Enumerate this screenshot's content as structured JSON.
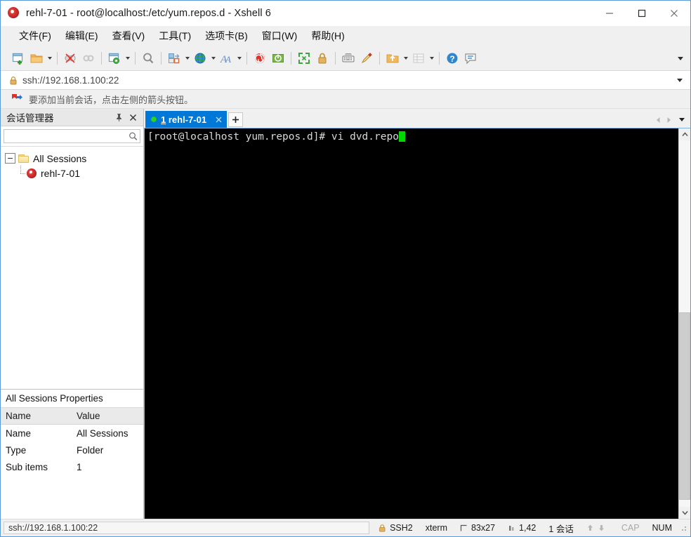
{
  "window": {
    "title": "rehl-7-01 - root@localhost:/etc/yum.repos.d - Xshell 6",
    "app_icon": "xshell-spiral-icon",
    "minimize_label": "—",
    "maximize_label": "□",
    "close_label": "✕"
  },
  "menubar": {
    "items": [
      {
        "label": "文件(F)",
        "name": "menu-file"
      },
      {
        "label": "编辑(E)",
        "name": "menu-edit"
      },
      {
        "label": "查看(V)",
        "name": "menu-view"
      },
      {
        "label": "工具(T)",
        "name": "menu-tools"
      },
      {
        "label": "选项卡(B)",
        "name": "menu-tabs"
      },
      {
        "label": "窗口(W)",
        "name": "menu-window"
      },
      {
        "label": "帮助(H)",
        "name": "menu-help"
      }
    ]
  },
  "toolbar": {
    "overflow_icon": "chevron-down-icon",
    "items": [
      {
        "name": "new-session-icon",
        "icon": "new-session"
      },
      {
        "name": "open-session-icon",
        "icon": "open-folder",
        "dropdown": true
      },
      {
        "name": "separator",
        "icon": "separator"
      },
      {
        "name": "disconnect-icon",
        "icon": "disconnect"
      },
      {
        "name": "reconnect-icon",
        "icon": "reconnect"
      },
      {
        "name": "separator",
        "icon": "separator"
      },
      {
        "name": "session-properties-icon",
        "icon": "properties",
        "dropdown": true
      },
      {
        "name": "separator",
        "icon": "separator"
      },
      {
        "name": "find-icon",
        "icon": "magnifier"
      },
      {
        "name": "separator",
        "icon": "separator"
      },
      {
        "name": "layout-icon",
        "icon": "layout",
        "dropdown": true
      },
      {
        "name": "globe-icon",
        "icon": "globe",
        "dropdown": true
      },
      {
        "name": "font-icon",
        "icon": "font-A",
        "dropdown": true
      },
      {
        "name": "separator",
        "icon": "separator"
      },
      {
        "name": "xshell-icon",
        "icon": "spiral"
      },
      {
        "name": "xftp-icon",
        "icon": "xftp"
      },
      {
        "name": "separator",
        "icon": "separator"
      },
      {
        "name": "fullscreen-icon",
        "icon": "fullscreen"
      },
      {
        "name": "lock-icon",
        "icon": "lock"
      },
      {
        "name": "separator",
        "icon": "separator"
      },
      {
        "name": "keyboard-icon",
        "icon": "keyboard"
      },
      {
        "name": "highlight-icon",
        "icon": "pen"
      },
      {
        "name": "separator",
        "icon": "separator"
      },
      {
        "name": "transfer-icon",
        "icon": "transfer",
        "dropdown": true
      },
      {
        "name": "compose-pane-icon",
        "icon": "grid",
        "dropdown": true,
        "disabled": true
      },
      {
        "name": "separator",
        "icon": "separator"
      },
      {
        "name": "help-icon",
        "icon": "question"
      },
      {
        "name": "chat-icon",
        "icon": "chat"
      }
    ]
  },
  "address_bar": {
    "lock_icon": "lock-icon",
    "value": "ssh://192.168.1.100:22",
    "dropdown_icon": "chevron-down-icon"
  },
  "notice_bar": {
    "icon": "add-session-arrow-icon",
    "text": "要添加当前会话，点击左侧的箭头按钮。"
  },
  "session_manager": {
    "title": "会话管理器",
    "pin_icon": "pin-icon",
    "close_icon": "close-icon",
    "search": {
      "value": "",
      "placeholder": "",
      "icon": "search-icon"
    },
    "tree": {
      "root": {
        "label": "All Sessions",
        "icon": "folder-icon",
        "expanded": true
      },
      "children": [
        {
          "label": "rehl-7-01",
          "icon": "xshell-session-icon"
        }
      ]
    }
  },
  "properties": {
    "title": "All Sessions Properties",
    "columns": [
      "Name",
      "Value"
    ],
    "rows": [
      {
        "name": "Name",
        "value": "All Sessions"
      },
      {
        "name": "Type",
        "value": "Folder"
      },
      {
        "name": "Sub items",
        "value": "1"
      }
    ]
  },
  "tabs": {
    "items": [
      {
        "index": "1",
        "label": "rehl-7-01",
        "active": true,
        "status": "connected",
        "close_icon": "close-icon"
      }
    ],
    "new_tab_label": "+",
    "nav_prev_icon": "chevron-left-icon",
    "nav_next_icon": "chevron-right-icon",
    "tab_menu_icon": "chevron-down-icon"
  },
  "terminal": {
    "prompt": "[root@localhost yum.repos.d]# ",
    "command": "vi dvd.repo",
    "cursor": "block-cursor",
    "background": "#000000",
    "foreground": "#d8d8d8",
    "cursor_color": "#00d800"
  },
  "scrollbar": {
    "up_icon": "chevron-up-icon",
    "down_icon": "chevron-down-icon"
  },
  "status_bar": {
    "connection": "ssh://192.168.1.100:22",
    "cells": [
      {
        "name": "status-protocol",
        "icon": "lock-icon",
        "label": "SSH2",
        "dim": false
      },
      {
        "name": "status-terminal-type",
        "icon": "",
        "label": "xterm",
        "dim": false
      },
      {
        "name": "status-size",
        "icon": "screen-icon",
        "label": "83x27",
        "dim": false
      },
      {
        "name": "status-cursor-position",
        "icon": "cursor-icon",
        "label": "1,42",
        "dim": false
      },
      {
        "name": "status-session-count",
        "icon": "",
        "label": "1 会话",
        "dim": false
      },
      {
        "name": "status-transfer-up",
        "icon": "arrow-up-icon",
        "label": "",
        "dim": true
      },
      {
        "name": "status-transfer-down",
        "icon": "arrow-down-icon",
        "label": "",
        "dim": true
      },
      {
        "name": "status-caps-lock",
        "icon": "",
        "label": "CAP",
        "dim": true
      },
      {
        "name": "status-num-lock",
        "icon": "",
        "label": "NUM",
        "dim": false
      }
    ]
  }
}
